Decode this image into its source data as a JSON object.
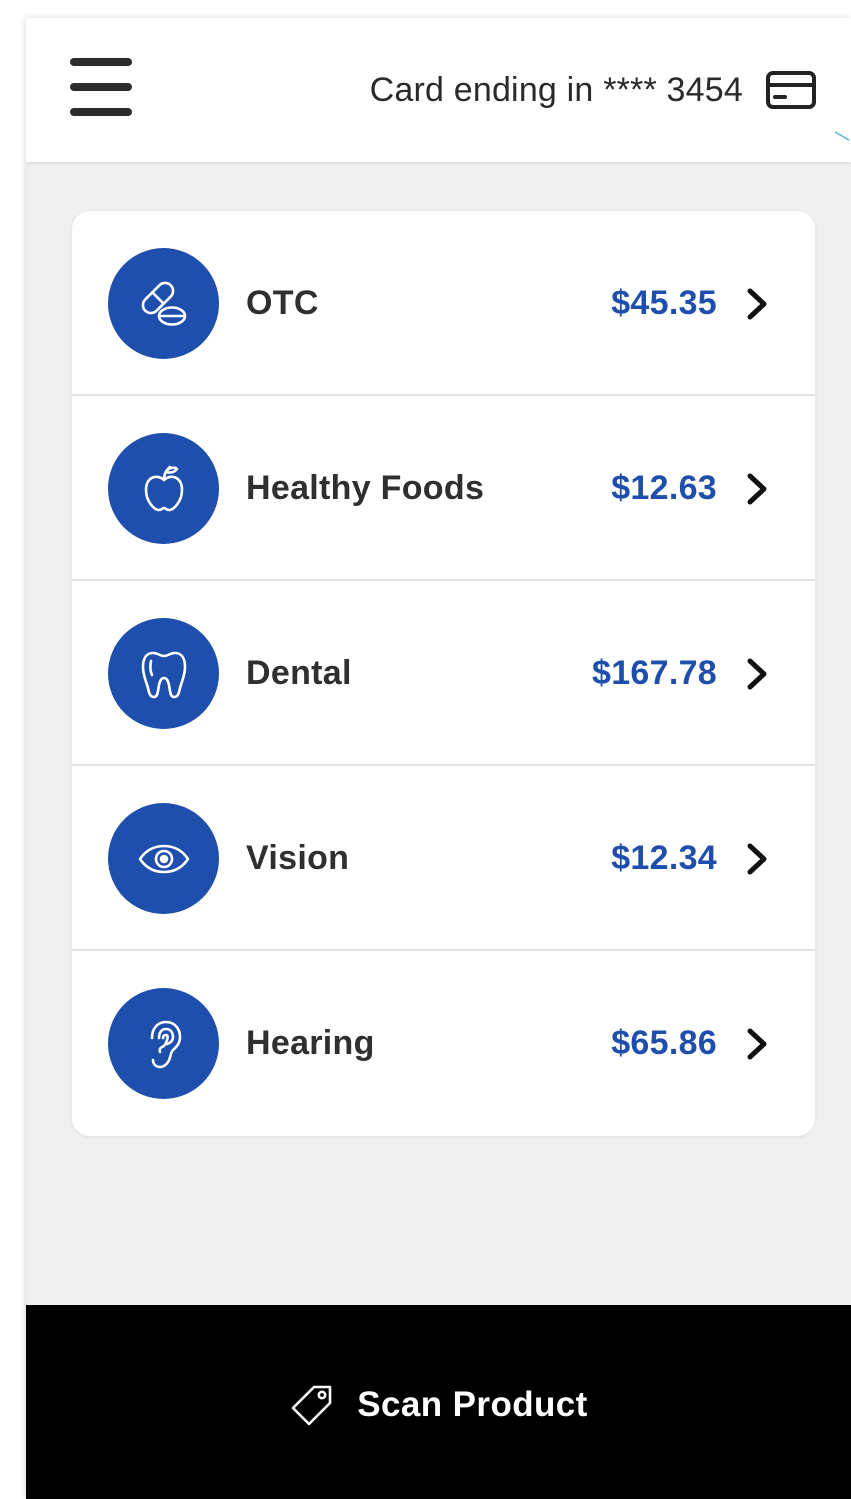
{
  "header": {
    "menu_icon": "hamburger-menu-icon",
    "card_text": "Card ending in **** 3454",
    "card_icon": "credit-card-icon"
  },
  "benefits": [
    {
      "label": "OTC",
      "amount": "$45.35",
      "icon": "pills-icon"
    },
    {
      "label": "Healthy Foods",
      "amount": "$12.63",
      "icon": "apple-icon"
    },
    {
      "label": "Dental",
      "amount": "$167.78",
      "icon": "tooth-icon"
    },
    {
      "label": "Vision",
      "amount": "$12.34",
      "icon": "eye-icon"
    },
    {
      "label": "Hearing",
      "amount": "$65.86",
      "icon": "ear-icon"
    }
  ],
  "footer": {
    "scan_label": "Scan Product",
    "scan_icon": "price-tag-icon"
  },
  "colors": {
    "accent": "#1f4fad",
    "background": "#f0f0f0",
    "footer": "#000000"
  }
}
